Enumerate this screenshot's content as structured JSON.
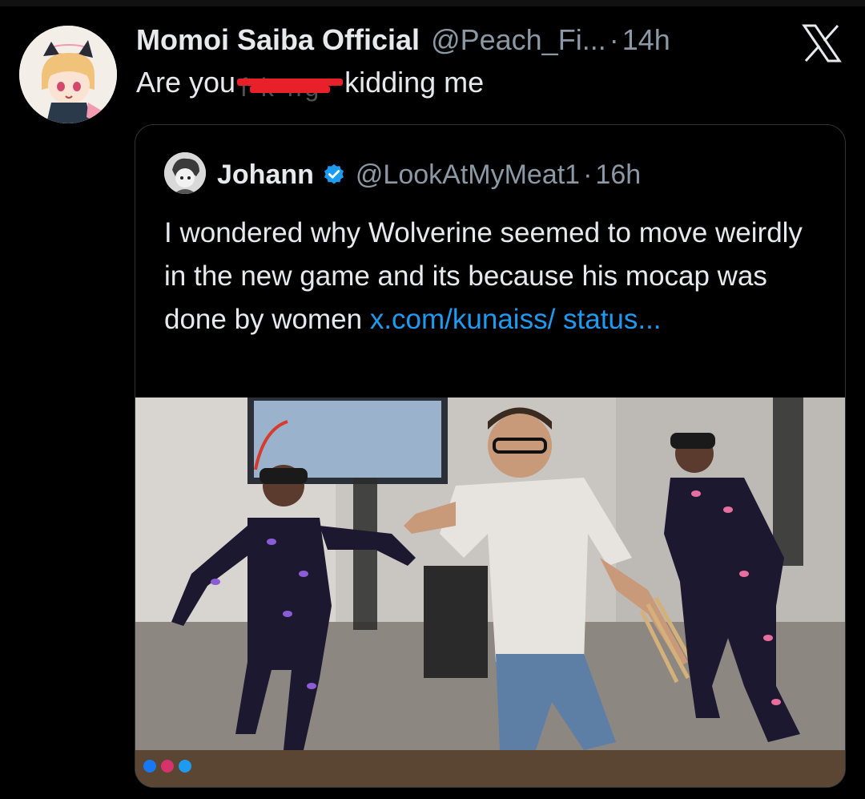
{
  "tweet": {
    "author_name": "Momoi Saiba Official",
    "author_handle": "@Peach_Fi...",
    "separator": "·",
    "time": "14h",
    "text_before": "Are you",
    "text_censored": "f   k ng",
    "text_after": "kidding me",
    "avatar_icon": "anime-girl-avatar",
    "logo_icon": "x-logo-icon"
  },
  "quoted_tweet": {
    "author_name": "Johann",
    "author_handle": "@LookAtMyMeat1",
    "separator": "·",
    "time": "16h",
    "verified_icon": "verified-badge-icon",
    "text": "I wondered why Wolverine seemed to move weirdly in the new game and its because his mocap was done by women ",
    "link_text": "x.com/kunaiss/ status...",
    "media_description_icon": "mocap-photo"
  },
  "colors": {
    "background": "#000000",
    "text": "#e7e9ea",
    "secondary": "#8b98a5",
    "link": "#1d9bf0",
    "verified": "#1d9bf0",
    "censor": "#e8202a"
  }
}
